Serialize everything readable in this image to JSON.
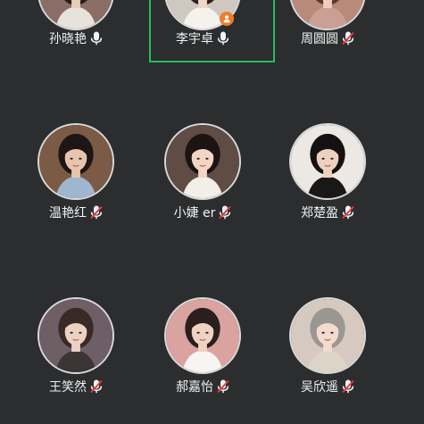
{
  "participants": [
    {
      "name": "孙晓艳",
      "mic": "on",
      "photo_bg": "#8a6e66",
      "skin": "#e9cdbd",
      "hair": "#2a1d1a",
      "outfit": "#e8e2dc"
    },
    {
      "name": "李宇卓",
      "mic": "on",
      "host": true,
      "photo_bg": "#cfc8c1",
      "skin": "#efd6c6",
      "hair": "#2d2220",
      "outfit": "#f5f2ee"
    },
    {
      "name": "周圆圆",
      "mic": "muted",
      "photo_bg": "#b88a7a",
      "skin": "#f0cdbd",
      "hair": "#5a3a2a",
      "outfit": "#c9a093"
    },
    {
      "name": "温艳红",
      "mic": "muted",
      "photo_bg": "#7b5a46",
      "skin": "#e7c4ad",
      "hair": "#1e1614",
      "outfit": "#9fb6cf"
    },
    {
      "name": "小婕 er",
      "mic": "muted",
      "photo_bg": "#5e4c45",
      "skin": "#f3d5c5",
      "hair": "#1b1412",
      "outfit": "#f2efe9"
    },
    {
      "name": "郑楚盈",
      "mic": "muted",
      "photo_bg": "#ece8e4",
      "skin": "#ecd0c0",
      "hair": "#151110",
      "outfit": "#1a1717"
    },
    {
      "name": "王笑然",
      "mic": "muted",
      "photo_bg": "#6e5e66",
      "skin": "#ecd2c3",
      "hair": "#3a2a26",
      "outfit": "#3b3535"
    },
    {
      "name": "郝嘉怡",
      "mic": "muted",
      "photo_bg": "#d9a3a0",
      "skin": "#f0d2c2",
      "hair": "#2a1f1c",
      "outfit": "#f7f4f2"
    },
    {
      "name": "吴欣遥",
      "mic": "muted",
      "photo_bg": "#d6c9c0",
      "skin": "#f3dbcd",
      "hair": "#9a9793",
      "outfit": "#ddd4c8"
    }
  ],
  "colors": {
    "background": "#2b2d2f",
    "name_text": "#f2f2f2",
    "selected_border": "#22c05a",
    "mute_slash": "#e53935",
    "host_badge": "#f07c2a",
    "avatar_border": "#d9d9d9"
  },
  "icons": {
    "mic_on": "microphone-icon",
    "mic_muted": "microphone-muted-icon",
    "host_badge": "person-badge-icon"
  }
}
